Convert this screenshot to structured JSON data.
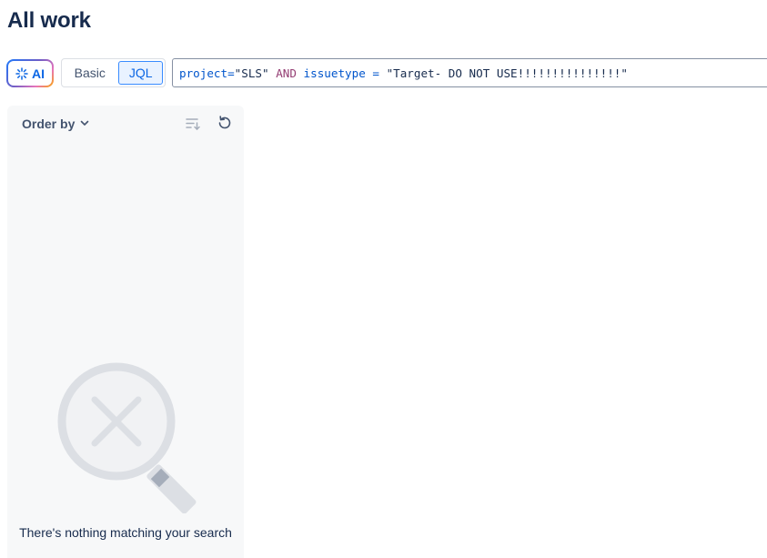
{
  "page": {
    "title": "All work"
  },
  "search": {
    "ai_label": "AI",
    "modes": {
      "basic": "Basic",
      "jql": "JQL",
      "active": "JQL"
    },
    "jql_tokens": [
      {
        "text": "project",
        "kind": "field"
      },
      {
        "text": "=",
        "kind": "op"
      },
      {
        "text": "\"SLS\"",
        "kind": "str"
      },
      {
        "text": " ",
        "kind": "sp"
      },
      {
        "text": "AND",
        "kind": "kw"
      },
      {
        "text": " ",
        "kind": "sp"
      },
      {
        "text": "issuetype",
        "kind": "field"
      },
      {
        "text": " ",
        "kind": "sp"
      },
      {
        "text": "=",
        "kind": "op"
      },
      {
        "text": " ",
        "kind": "sp"
      },
      {
        "text": "\"Target- DO NOT USE!!!!!!!!!!!!!!!\"",
        "kind": "str"
      }
    ]
  },
  "sidebar": {
    "order_by_label": "Order by",
    "empty_state_text": "There's nothing matching your search",
    "icons": [
      "chevron-down-icon",
      "sort-icon",
      "refresh-icon",
      "no-results-magnifier-icon",
      "sparkle-icon"
    ]
  },
  "colors": {
    "accent": "#0c66e4",
    "selected_bg": "#e9f2ff",
    "panel_bg": "#f7f8f9",
    "keyword": "#943d73",
    "illustration": "#dcdfe4"
  }
}
